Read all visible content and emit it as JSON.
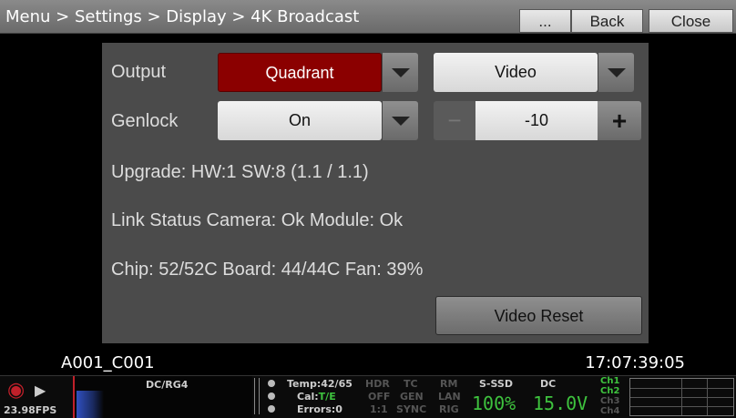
{
  "header": {
    "breadcrumb": "Menu > Settings > Display > 4K Broadcast",
    "more_label": "...",
    "back_label": "Back",
    "close_label": "Close"
  },
  "panel": {
    "output_label": "Output",
    "output_value": "Quadrant",
    "output_mode": "Video",
    "genlock_label": "Genlock",
    "genlock_value": "On",
    "offset_value": "-10",
    "minus_symbol": "−",
    "plus_symbol": "+",
    "upgrade": "Upgrade: HW:1  SW:8    (1.1 / 1.1)",
    "link_status": "Link Status  Camera: Ok   Module: Ok",
    "temps": "Chip: 52/52C  Board: 44/44C  Fan: 39%",
    "video_reset_label": "Video Reset"
  },
  "footer": {
    "clip_name": "A001_C001",
    "timecode": "17:07:39:05"
  },
  "status": {
    "fps": "23.98FPS",
    "color_space": "DC/RG4",
    "temp": "Temp:42/65",
    "cal_prefix": "Cal:",
    "cal_value": "T/E",
    "errors": "Errors:0",
    "hdr": "HDR",
    "off": "OFF",
    "ratio": "1:1",
    "tc": "TC",
    "gen": "GEN",
    "sync": "SYNC",
    "rm": "RM",
    "lan": "LAN",
    "rig": "RIG",
    "media_label": "S-SSD",
    "media_value": "100%",
    "power_label": "DC",
    "power_value": "15.0V",
    "ch1": "Ch1",
    "ch2": "Ch2",
    "ch3": "Ch3",
    "ch4": "Ch4"
  },
  "colors": {
    "accent_red": "#8b0000",
    "status_green": "#3ec23e"
  }
}
